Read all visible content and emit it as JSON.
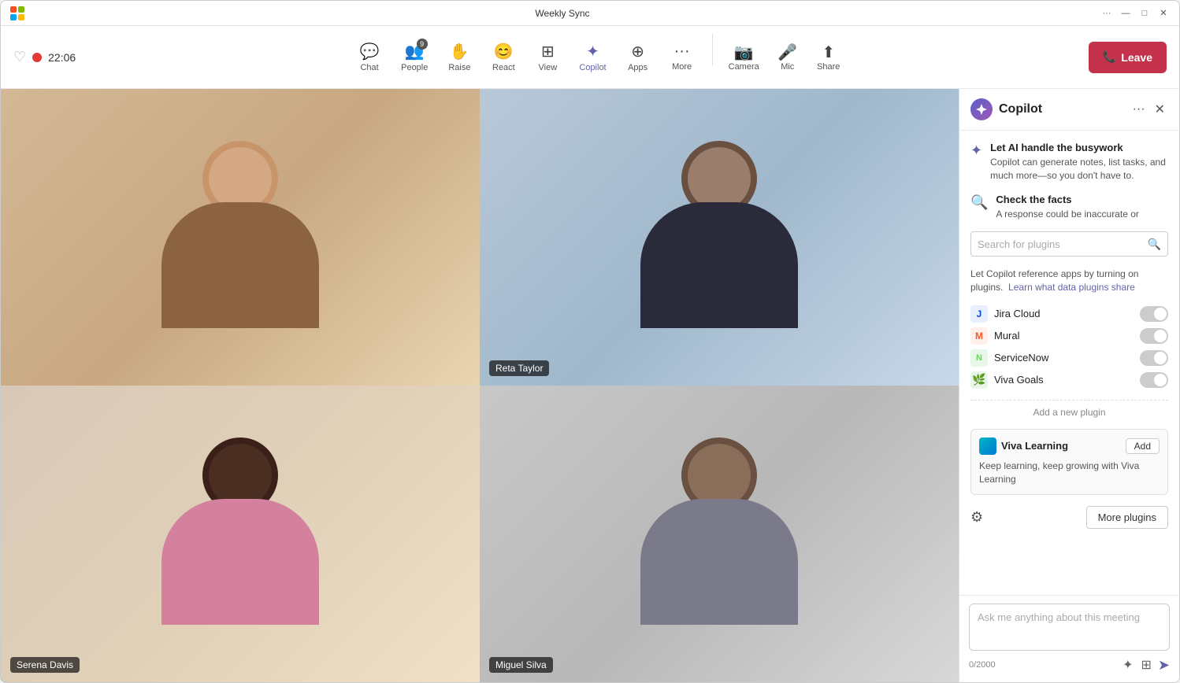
{
  "window": {
    "title": "Weekly Sync"
  },
  "titlebar": {
    "more_label": "···",
    "minimize_label": "—",
    "maximize_label": "□",
    "close_label": "✕"
  },
  "toolbar": {
    "timer": "22:06",
    "chat_label": "Chat",
    "people_label": "People",
    "people_count": "9",
    "raise_label": "Raise",
    "react_label": "React",
    "view_label": "View",
    "copilot_label": "Copilot",
    "apps_label": "Apps",
    "more_label": "More",
    "camera_label": "Camera",
    "mic_label": "Mic",
    "share_label": "Share",
    "leave_label": "Leave"
  },
  "video_cells": [
    {
      "id": "cell1",
      "name": null,
      "show_name": false
    },
    {
      "id": "cell2",
      "name": "Reta Taylor",
      "show_name": true
    },
    {
      "id": "cell3",
      "name": "Serena Davis",
      "show_name": true
    },
    {
      "id": "cell4",
      "name": "Miguel Silva",
      "show_name": true
    }
  ],
  "copilot": {
    "title": "Copilot",
    "feature1": {
      "heading": "Let AI handle the busywork",
      "desc": "Copilot can generate notes, list tasks, and much more—so you don't have to."
    },
    "feature2": {
      "heading": "Check the facts",
      "desc": "A response could be inaccurate or"
    },
    "search_placeholder": "Search for plugins",
    "plugins_hint": "Let Copilot reference apps by turning on plugins.",
    "plugins_link": "Learn what data plugins share",
    "plugins": [
      {
        "name": "Jira Cloud",
        "icon": "J",
        "color": "#0052cc",
        "bg": "#e8f0ff"
      },
      {
        "name": "Mural",
        "icon": "M",
        "color": "#f05a28",
        "bg": "#fff0eb"
      },
      {
        "name": "ServiceNow",
        "icon": "N",
        "color": "#62d84e",
        "bg": "#f0fff0"
      },
      {
        "name": "Viva Goals",
        "icon": "V",
        "color": "#3c8dbc",
        "bg": "#e8f5ff"
      }
    ],
    "add_plugin_label": "Add a new plugin",
    "viva_learning": {
      "name": "Viva Learning",
      "desc": "Keep learning, keep growing with Viva Learning",
      "add_label": "Add"
    },
    "more_plugins_label": "More plugins",
    "input_placeholder": "Ask me anything about this meeting",
    "char_count": "0/2000"
  }
}
